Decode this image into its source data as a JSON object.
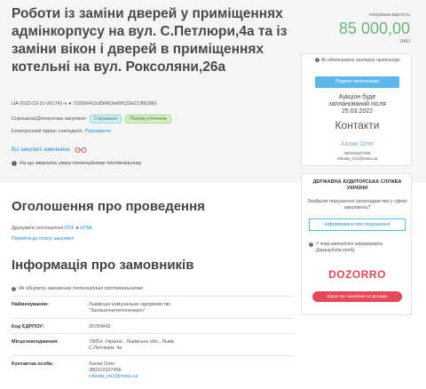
{
  "tender": {
    "title": "Роботи із заміни дверей у приміщеннях адмінкорпусу на вул. С.Петлюри,4а та із заміни вікон і дверей в приміщеннях котельні на вул. Роксоляни,26а",
    "id": "UA-2022-03-21-001741-e ● 718306415d58463e89f133e213f62981",
    "procedure": "Спрощена/Допорогова закупівля",
    "tag_simplified": "Спрощено",
    "tag_period": "Період уточнень",
    "signature_text": "Електронний підпис накладено.",
    "signature_link": "Перевірити",
    "all_customer_purchases": "Всі закупівлі замовника",
    "notice_text": "На що звернути увагу потенційному постачальнику"
  },
  "price": {
    "label": "очікувана вартість",
    "amount": "85 000,00",
    "currency": "UAH"
  },
  "side": {
    "warning": "Як підготувати пендерну пропозицію",
    "offer_button": "Подати пропозицію",
    "auction_line1": "Аукціон буде",
    "auction_line2": "запланований після",
    "auction_date": "25.03.2022",
    "contacts_title": "Контакти",
    "contact_name": "Халак Олег",
    "contact_phone": "380322627456",
    "contact_email": "roboda_ziz1@meta.ua"
  },
  "audit": {
    "title": "ДЕРЖАВНА АУДИТОРСЬКА СЛУЖБА УКРАЇНИ",
    "question": "Знайшли порушення законодавства у сфері закупівель?",
    "inform_button": "Інформувати про порушення",
    "note": "У чому методичні інформувати Держаудитслужбу",
    "dozorro_logo": "DOZORRO",
    "review_button": "Відгук про закупівлю на Дозорро"
  },
  "announcement": {
    "title": "Оголошення про проведення",
    "print_label": "Друкувати оголошення",
    "print_pdf": "PDF",
    "print_html": "HTML",
    "goto_plan": "Перейти до плану закупівлі"
  },
  "customer": {
    "title": "Інформація про замовників",
    "warning": "Як обирати замовника потенційним постачальникам",
    "rows": [
      {
        "label": "Найменування:",
        "value": "Львівське комунальне підприємство",
        "value2": "\"Залізничнетеплоенерго\""
      },
      {
        "label": "Код ЄДРПОУ:",
        "value": "20784943",
        "value2": ""
      },
      {
        "label": "Місцезнаходження:",
        "value": "79054, Україна , Львівська обл., Львів,",
        "value2": "С.Петлюри, 4а"
      },
      {
        "label": "Контактна особа:",
        "value": "Халак Олег",
        "value2": "380322627456",
        "value3": "roboda_ziz1@meta.ua"
      }
    ]
  },
  "colors": {
    "price_green": "#6db57a",
    "link_blue": "#2b8bd0",
    "button_blue": "#5eb7ea",
    "dozorro_red": "#e24a5a"
  }
}
